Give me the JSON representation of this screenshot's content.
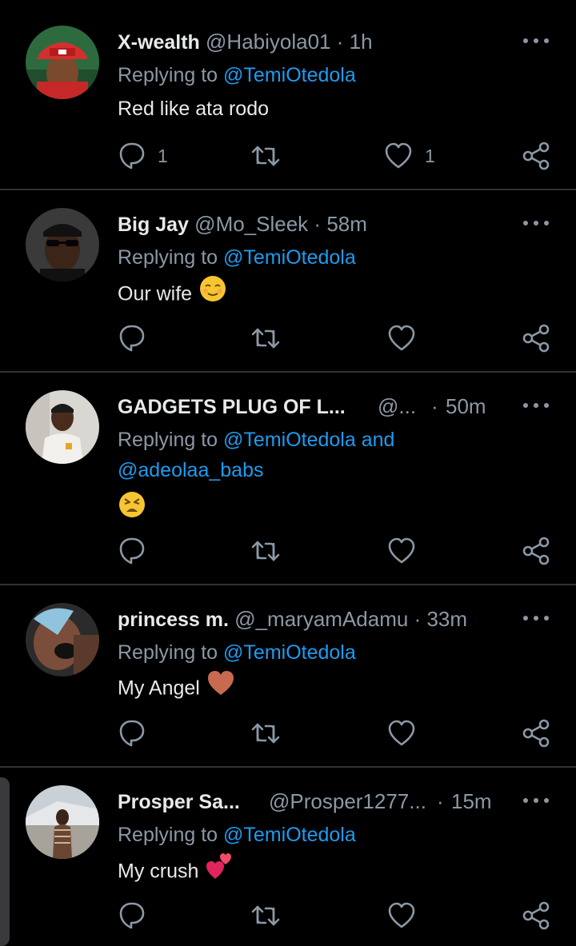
{
  "tweets": [
    {
      "name": "X-wealth",
      "handle": "@Habiyola01",
      "time": "1h",
      "replying_prefix": "Replying to ",
      "replying_to": "@TemiOtedola",
      "text": "Red like ata rodo",
      "reply_count": "1",
      "like_count": "1"
    },
    {
      "name": "Big Jay",
      "handle": "@Mo_Sleek",
      "time": "58m",
      "replying_prefix": "Replying to ",
      "replying_to": "@TemiOtedola",
      "text": "Our wife",
      "emoji": "relieved-face-emoji"
    },
    {
      "name": "GADGETS PLUG OF L...",
      "handle": "@...",
      "time": "50m",
      "replying_prefix": "Replying to ",
      "replying_to": "@TemiOtedola and",
      "replying_to_2": "@adeolaa_babs",
      "emoji": "tired-face-emoji"
    },
    {
      "name": "princess m.",
      "handle": "@_maryamAdamu",
      "time": "33m",
      "replying_prefix": "Replying to ",
      "replying_to": "@TemiOtedola",
      "text": "My Angel",
      "emoji": "brown-heart-emoji"
    },
    {
      "name": "Prosper Sa...",
      "handle": "@Prosper1277...",
      "time": "15m",
      "replying_prefix": "Replying to ",
      "replying_to": "@TemiOtedola",
      "text": "My crush",
      "emoji": "two-hearts-emoji"
    }
  ],
  "separator": "·",
  "icons": {
    "more": "more-icon",
    "reply": "reply-icon",
    "retweet": "retweet-icon",
    "like": "heart-icon",
    "share": "share-icon"
  },
  "colors": {
    "background": "#000000",
    "text": "#e7e9ea",
    "muted": "#8b98a5",
    "link": "#1d9bf0",
    "divider": "#2f3336"
  }
}
